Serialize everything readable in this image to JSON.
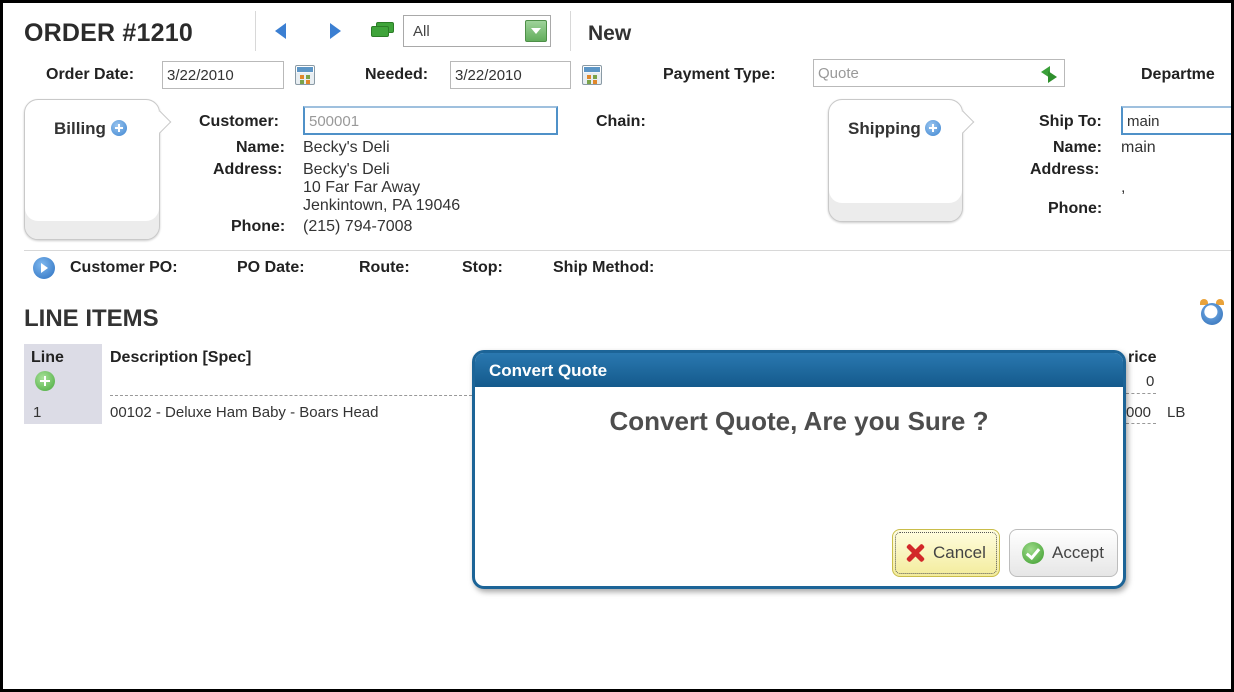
{
  "header": {
    "order_title": "ORDER #1210",
    "filter_select": "All",
    "status": "New"
  },
  "fields": {
    "order_date_label": "Order Date:",
    "order_date": "3/22/2010",
    "needed_label": "Needed:",
    "needed": "3/22/2010",
    "payment_type_label": "Payment Type:",
    "payment_type": "Quote",
    "department_label": "Departme"
  },
  "billing": {
    "tab_label": "Billing",
    "customer_label": "Customer:",
    "customer": "500001",
    "name_label": "Name:",
    "name": "Becky's Deli",
    "address_label": "Address:",
    "address_line1": "Becky's Deli",
    "address_line2": "10 Far Far Away",
    "address_line3": "Jenkintown, PA 19046",
    "phone_label": "Phone:",
    "phone": "(215) 794-7008",
    "chain_label": "Chain:"
  },
  "shipping": {
    "tab_label": "Shipping",
    "ship_to_label": "Ship To:",
    "ship_to": "main",
    "name_label": "Name:",
    "name": "main",
    "address_label": "Address:",
    "address_value": ",",
    "phone_label": "Phone:"
  },
  "po_bar": {
    "customer_po_label": "Customer PO:",
    "po_date_label": "PO Date:",
    "route_label": "Route:",
    "stop_label": "Stop:",
    "ship_method_label": "Ship Method:"
  },
  "line_items": {
    "title": "LINE ITEMS",
    "columns": [
      "Line",
      "Description [Spec]",
      "rice"
    ],
    "rows": [
      {
        "line": "1",
        "description": "00102 - Deluxe Ham Baby - Boars Head",
        "price_partial": "000",
        "unit": "LB",
        "price_top": "0"
      }
    ]
  },
  "modal": {
    "title": "Convert Quote",
    "message": "Convert Quote, Are you Sure ?",
    "cancel_label": "Cancel",
    "accept_label": "Accept"
  },
  "colors": {
    "accent_blue": "#1c6497",
    "nav_blue": "#3b7fd2",
    "cancel_bg": "#f3ec9c"
  }
}
